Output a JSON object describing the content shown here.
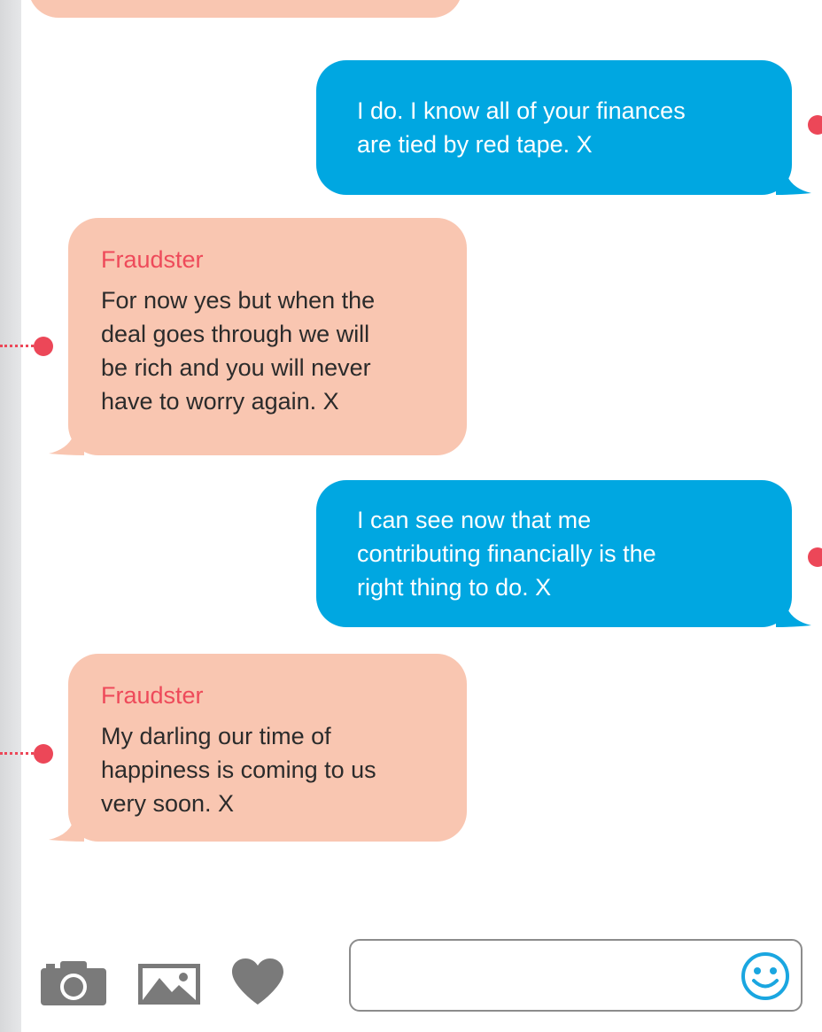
{
  "conversation": {
    "messages": [
      {
        "direction": "sent",
        "text": "I do. I know all of your finances\nare tied by red tape. X"
      },
      {
        "direction": "received",
        "sender": "Fraudster",
        "text": "For now yes but when the\ndeal goes through we will\nbe rich and you will never\nhave to worry again. X"
      },
      {
        "direction": "sent",
        "text": "I can see now that me\ncontributing financially is the\nright thing to do. X"
      },
      {
        "direction": "received",
        "sender": "Fraudster",
        "text": "My darling our time of\nhappiness is coming to us\nvery soon. X"
      }
    ]
  },
  "composer": {
    "input_value": "",
    "icons": [
      "camera-icon",
      "image-icon",
      "heart-icon",
      "smiley-icon"
    ]
  },
  "colors": {
    "received_bubble": "#f9c6b1",
    "sent_bubble": "#00a7e1",
    "sender_name": "#ee4a5a",
    "annotation_dot": "#ec4758",
    "icon_gray": "#7a7a7a",
    "emoji_blue": "#1aa6e0"
  }
}
